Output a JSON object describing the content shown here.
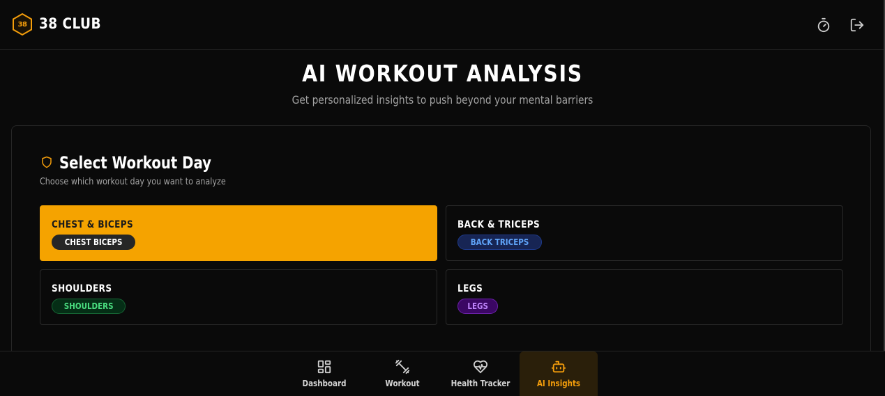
{
  "header": {
    "logo_text": "38",
    "brand": "38 CLUB",
    "icons": [
      "timer-icon",
      "logout-icon"
    ]
  },
  "page": {
    "title": "AI WORKOUT ANALYSIS",
    "subtitle": "Get personalized insights to push beyond your mental barriers"
  },
  "section": {
    "icon": "shield-icon",
    "title": "Select Workout Day",
    "description": "Choose which workout day you want to analyze"
  },
  "days": [
    {
      "name": "CHEST & BICEPS",
      "badge": "CHEST BICEPS",
      "selected": true,
      "badge_bg": "#262626",
      "badge_border": "#262626",
      "badge_color": "#ffffff"
    },
    {
      "name": "BACK & TRICEPS",
      "badge": "BACK TRICEPS",
      "selected": false,
      "badge_bg": "#172554",
      "badge_border": "#1e3a8a",
      "badge_color": "#60a5fa"
    },
    {
      "name": "SHOULDERS",
      "badge": "SHOULDERS",
      "selected": false,
      "badge_bg": "#052e16",
      "badge_border": "#166534",
      "badge_color": "#4ade80"
    },
    {
      "name": "LEGS",
      "badge": "LEGS",
      "selected": false,
      "badge_bg": "#3b0764",
      "badge_border": "#6b21a8",
      "badge_color": "#c084fc"
    }
  ],
  "nav": [
    {
      "label": "Dashboard",
      "icon": "dashboard-icon",
      "active": false
    },
    {
      "label": "Workout",
      "icon": "dumbbell-icon",
      "active": false
    },
    {
      "label": "Health Tracker",
      "icon": "heart-pulse-icon",
      "active": false
    },
    {
      "label": "AI Insights",
      "icon": "robot-icon",
      "active": true
    }
  ],
  "colors": {
    "accent": "#f59e0b",
    "background": "#0a0a0a",
    "border": "#262626"
  }
}
